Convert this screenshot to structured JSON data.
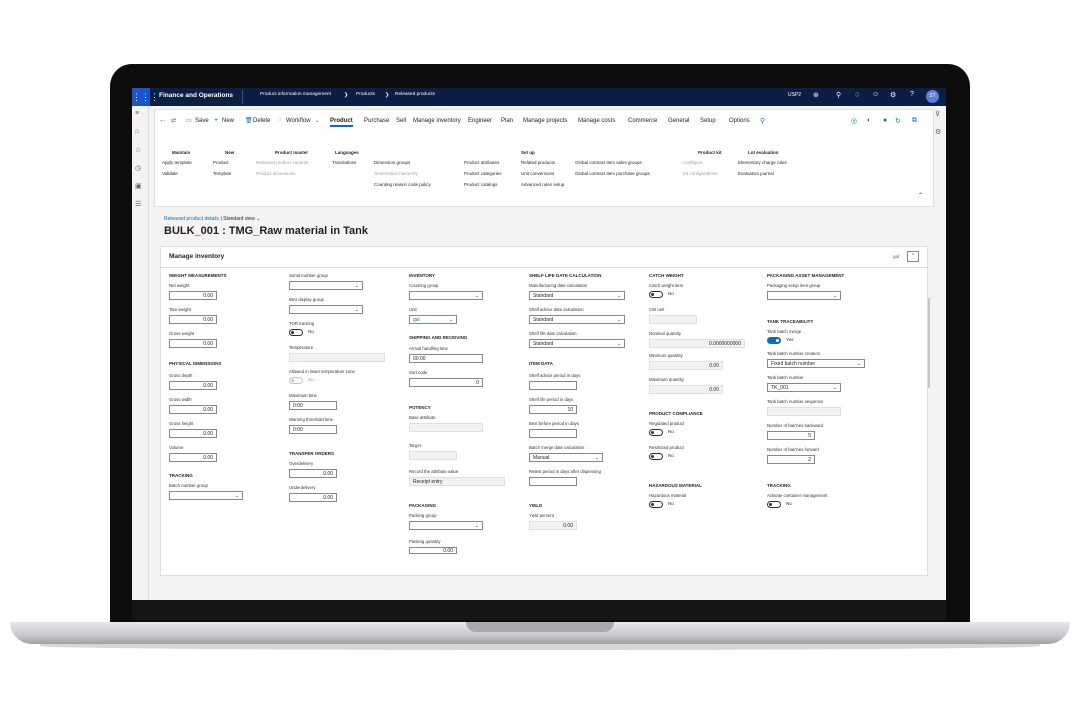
{
  "topbar": {
    "app_title": "Finance and Operations",
    "breadcrumb": [
      "Product information management",
      "Products",
      "Released products"
    ],
    "company": "USP2",
    "avatar_initials": "ST"
  },
  "actionpane": {
    "save": "Save",
    "new": "New",
    "delete": "Delete",
    "workflow": "Workflow",
    "tabs": [
      "Product",
      "Purchase",
      "Sell",
      "Manage inventory",
      "Engineer",
      "Plan",
      "Manage projects",
      "Manage costs",
      "Commerce",
      "General",
      "Setup",
      "Options"
    ],
    "groups": {
      "maintain": {
        "header": "Maintain",
        "items": [
          "Apply template",
          "Validate"
        ]
      },
      "new": {
        "header": "New",
        "items": [
          "Product",
          "Template"
        ]
      },
      "product_master": {
        "header": "Product master",
        "items": [
          "Released product variants",
          "Product dimensions"
        ]
      },
      "languages": {
        "header": "Languages",
        "items": [
          "Translations"
        ]
      },
      "col5": {
        "items": [
          "Dimension groups",
          "Reservation hierarchy",
          "Counting reason code policy"
        ]
      },
      "col6": {
        "items": [
          "Product attributes",
          "Product categories",
          "Product catalogs"
        ]
      },
      "setup": {
        "header": "Set up",
        "items": [
          "Related products",
          "Unit conversions",
          "Advanced rules setup"
        ]
      },
      "col8": {
        "items": [
          "Global contract item sales groups",
          "Global contract item purchase groups"
        ]
      },
      "product_kit": {
        "header": "Product kit",
        "items": [
          "Configure",
          "Kit configurations"
        ]
      },
      "lot_evaluation": {
        "header": "Lot evaluation",
        "items": [
          "Elementary charge rules",
          "Evaluation journal"
        ]
      }
    }
  },
  "page": {
    "breadcrumb_link": "Released product details",
    "view": "Standard view",
    "title": "BULK_001 : TMG_Raw material in Tank"
  },
  "card": {
    "title": "Manage inventory",
    "unit_link": "gal",
    "col1": {
      "weight_measurements": "WEIGHT MEASUREMENTS",
      "net_weight": {
        "label": "Net weight",
        "value": "0.00"
      },
      "tare_weight": {
        "label": "Tare weight",
        "value": "0.00"
      },
      "gross_weight": {
        "label": "Gross weight",
        "value": "0.00"
      },
      "physical_dimensions": "PHYSICAL DIMENSIONS",
      "gross_depth": {
        "label": "Gross depth",
        "value": "0.00"
      },
      "gross_width": {
        "label": "Gross width",
        "value": "0.00"
      },
      "gross_height": {
        "label": "Gross height",
        "value": "0.00"
      },
      "volume": {
        "label": "Volume",
        "value": "0.00"
      },
      "tracking": "TRACKING",
      "batch_number_group": {
        "label": "Batch number group",
        "value": ""
      }
    },
    "col2": {
      "serial_number_group": {
        "label": "Serial number group",
        "value": ""
      },
      "bom_display_group": {
        "label": "IBAI display group",
        "value": ""
      },
      "tor_tracking": {
        "label": "TOR tracking",
        "value": "No"
      },
      "temperature": {
        "label": "Temperature",
        "value": ""
      },
      "allowed_lower_temp": {
        "label": "Allowed in lower temperature zone",
        "value": "No"
      },
      "maximum_time": {
        "label": "Maximum time",
        "value": "0:00"
      },
      "warning_threshold": {
        "label": "Warning threshold time",
        "value": "0:00"
      },
      "transfer_orders": "TRANSFER ORDERS",
      "overdelivery": {
        "label": "Overdelivery",
        "value": "0.00"
      },
      "underdelivery": {
        "label": "Underdelivery",
        "value": "0.00"
      }
    },
    "col3": {
      "inventory": "INVENTORY",
      "counting_group": {
        "label": "Counting group",
        "value": ""
      },
      "unit": {
        "label": "Unit",
        "value": "gal"
      },
      "shipping": "SHIPPING AND RECEIVING",
      "arrival_handling": {
        "label": "Arrival handling time",
        "value": "00:00"
      },
      "sort_code": {
        "label": "Sort code",
        "value": "0"
      },
      "potency": "POTENCY",
      "base_attribute": {
        "label": "Base attribute",
        "value": ""
      },
      "target": {
        "label": "Target",
        "value": ""
      },
      "record_attribute": {
        "label": "Record the attribute value",
        "value": "Receipt entry"
      },
      "packaging": "PACKAGING",
      "packing_group": {
        "label": "Packing group",
        "value": ""
      },
      "packing_quantity": {
        "label": "Packing quantity",
        "value": "0.00"
      }
    },
    "col4": {
      "shelf_life": "SHELF LIFE DATE CALCULATION",
      "manufacturing_date": {
        "label": "Manufacturing date calculation",
        "value": "Standard"
      },
      "shelf_advice_calc": {
        "label": "Shelf advice date calculation",
        "value": "Standard"
      },
      "shelf_life_calc": {
        "label": "Shelf life date calculation",
        "value": "Standard"
      },
      "item_data": "ITEM DATA",
      "shelf_advice_period": {
        "label": "Shelf advice period in days",
        "value": ""
      },
      "shelf_life_period": {
        "label": "Shelf life period in days",
        "value": "10"
      },
      "best_before": {
        "label": "Best before period in days",
        "value": ""
      },
      "batch_merge_date": {
        "label": "Batch merge date calculation",
        "value": "Manual"
      },
      "retest_period": {
        "label": "Retest period in days after dispensing",
        "value": ""
      },
      "yield": "YIELD",
      "yield_percent": {
        "label": "Yield percent",
        "value": "0.00"
      }
    },
    "col5": {
      "catch_weight": "CATCH WEIGHT",
      "catch_weight_item": {
        "label": "Catch weight item",
        "value": "No"
      },
      "cw_unit": {
        "label": "CW unit",
        "value": ""
      },
      "nominal_quantity": {
        "label": "Nominal quantity",
        "value": "0.0000000000"
      },
      "minimum_quantity": {
        "label": "Minimum quantity",
        "value": "0.00"
      },
      "maximum_quantity": {
        "label": "Maximum quantity",
        "value": "0.00"
      },
      "product_compliance": "PRODUCT COMPLIANCE",
      "regulated_product": {
        "label": "Regulated product",
        "value": "No"
      },
      "restricted_product": {
        "label": "Restricted product",
        "value": "No"
      },
      "hazardous": "HAZARDOUS MATERIAL",
      "hazardous_material": {
        "label": "Hazardous material",
        "value": "No"
      }
    },
    "col6": {
      "packaging_asset": "PACKAGING ASSET MANAGEMENT",
      "packaging_setup_group": {
        "label": "Packaging setup item group",
        "value": ""
      },
      "tank_traceability": "TANK TRACEABILITY",
      "tank_batch_merge": {
        "label": "Tank batch merge",
        "value": "Yes"
      },
      "tank_batch_creation": {
        "label": "Tank batch number creation",
        "value": "Fixed batch number"
      },
      "tank_batch_number": {
        "label": "Tank batch number",
        "value": "TK_001"
      },
      "tank_batch_sequence": {
        "label": "Tank batch number sequence",
        "value": ""
      },
      "batches_backward": {
        "label": "Number of batches backward",
        "value": "5"
      },
      "batches_forward": {
        "label": "Number of batches forward",
        "value": "2"
      },
      "tracking": "TRACKING",
      "activate_container": {
        "label": "Activate container management",
        "value": "No"
      }
    }
  }
}
